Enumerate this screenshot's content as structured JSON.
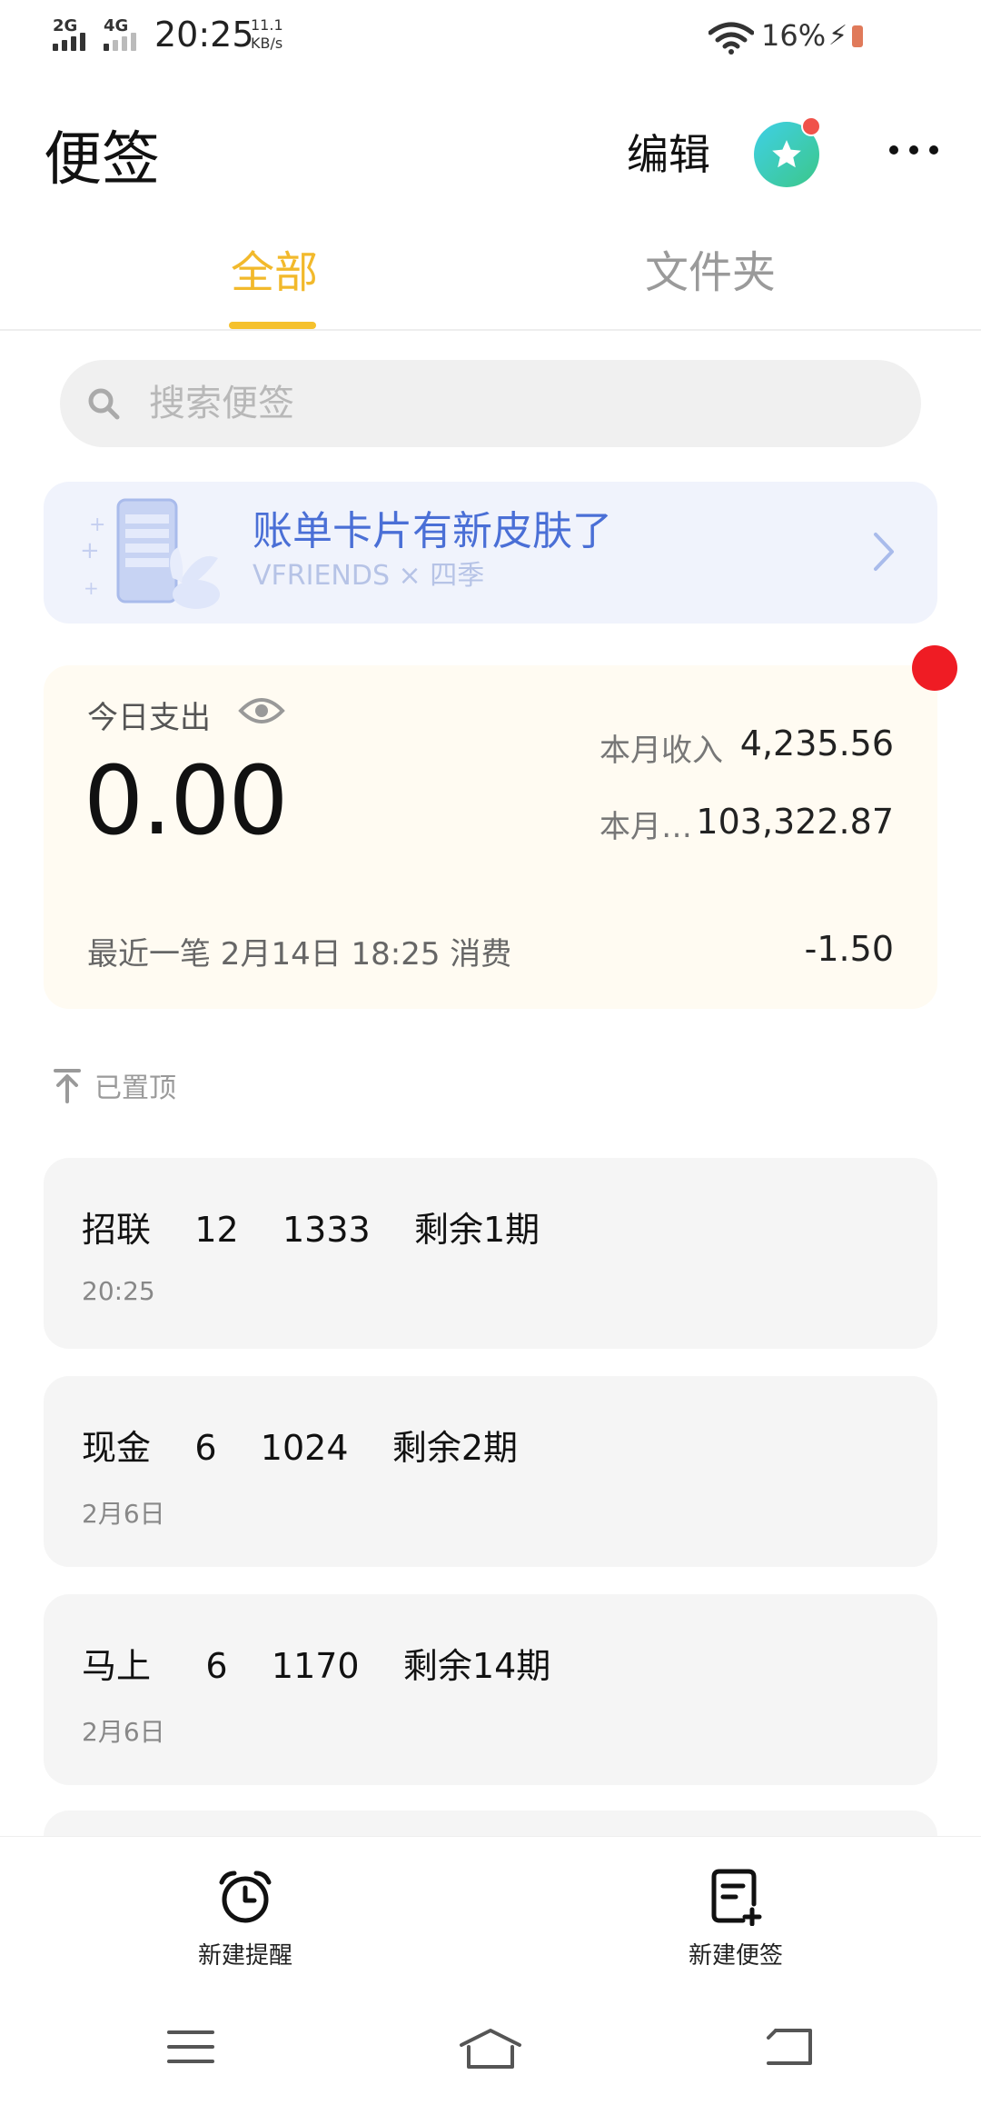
{
  "status_bar": {
    "network_1": "2G",
    "network_2": "4G",
    "time": "20:25",
    "speed_value": "11.1",
    "speed_unit": "KB/s",
    "battery": "16%"
  },
  "header": {
    "title": "便签",
    "edit_label": "编辑"
  },
  "tabs": [
    {
      "label": "全部",
      "active": true
    },
    {
      "label": "文件夹",
      "active": false
    }
  ],
  "search": {
    "placeholder": "搜索便签"
  },
  "banner": {
    "title": "账单卡片有新皮肤了",
    "subtitle": "VFRIENDS × 四季"
  },
  "expense_card": {
    "today_label": "今日支出",
    "today_value": "0.00",
    "month_income_label": "本月收入",
    "month_income_value": "4,235.56",
    "month_other_label": "本月…",
    "month_other_value": "103,322.87",
    "recent_text": "最近一笔  2月14日  18:25   消费",
    "recent_amount": "-1.50"
  },
  "pinned_label": "已置顶",
  "notes": [
    {
      "title": "招联    12    1333    剩余1期",
      "time": "20:25"
    },
    {
      "title": "现金    6    1024    剩余2期",
      "time": "2月6日"
    },
    {
      "title": "马上     6    1170    剩余14期",
      "time": "2月6日"
    }
  ],
  "actions": {
    "new_reminder": "新建提醒",
    "new_note": "新建便签"
  },
  "colors": {
    "accent": "#f5c12d",
    "banner_text": "#4a6fd6",
    "badge_red": "#ef1c24"
  }
}
